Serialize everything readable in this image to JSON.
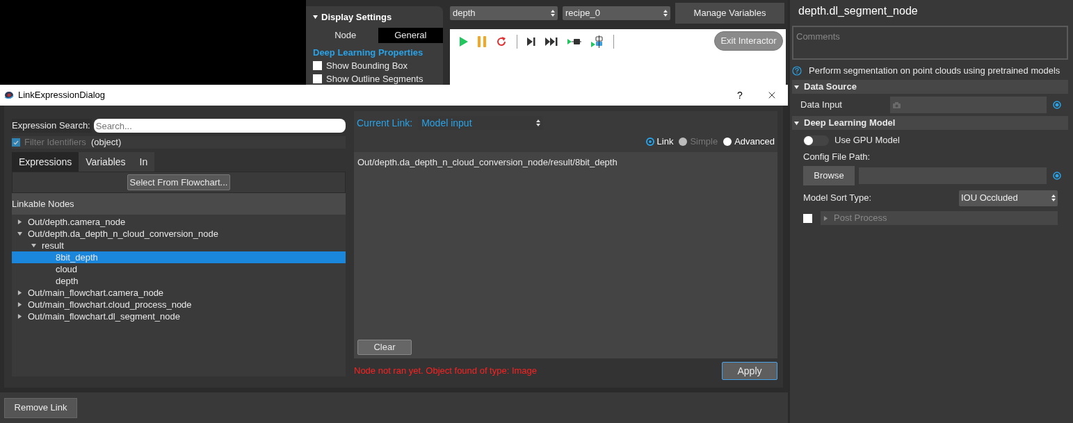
{
  "background": {
    "display_settings": {
      "title": "Display Settings",
      "tabs": [
        {
          "label": "Node",
          "selected": false
        },
        {
          "label": "General",
          "selected": true
        }
      ],
      "section": "Deep Learning Properties",
      "checkboxes": [
        {
          "label": "Show Bounding Box",
          "checked": false
        },
        {
          "label": "Show Outline Segments",
          "checked": false
        }
      ]
    },
    "selectors": [
      {
        "value": "depth"
      },
      {
        "value": "recipe_0"
      }
    ],
    "manage_button": "Manage Variables",
    "exit_button": "Exit Interactor"
  },
  "dialog": {
    "title": "LinkExpressionDialog",
    "help": "?",
    "search": {
      "label": "Expression Search:",
      "placeholder": "Search..."
    },
    "filter": {
      "label": "Filter Identifiers",
      "checked": true,
      "disabled": true,
      "type": "(object)"
    },
    "tabs": [
      {
        "label": "Expressions",
        "selected": true
      },
      {
        "label": "Variables",
        "selected": false
      },
      {
        "label": "In",
        "selected": false
      }
    ],
    "select_button": "Select From Flowchart...",
    "tree_header": "Linkable Nodes",
    "tree": [
      {
        "label": "Out/depth.camera_node",
        "expanded": false,
        "selected": false
      },
      {
        "label": "Out/depth.da_depth_n_cloud_conversion_node",
        "expanded": true,
        "selected": false,
        "children": [
          {
            "label": "result",
            "expanded": true,
            "selected": false,
            "children": [
              {
                "label": "8bit_depth",
                "selected": true
              },
              {
                "label": "cloud",
                "selected": false
              },
              {
                "label": "depth",
                "selected": false
              }
            ]
          }
        ]
      },
      {
        "label": "Out/main_flowchart.camera_node",
        "expanded": false,
        "selected": false
      },
      {
        "label": "Out/main_flowchart.cloud_process_node",
        "expanded": false,
        "selected": false
      },
      {
        "label": "Out/main_flowchart.dl_segment_node",
        "expanded": false,
        "selected": false
      }
    ],
    "current_link": {
      "label": "Current Link:",
      "value": "Model input"
    },
    "modes": [
      {
        "label": "Link",
        "selected": true,
        "disabled": false
      },
      {
        "label": "Simple",
        "selected": false,
        "disabled": true
      },
      {
        "label": "Advanced",
        "selected": false,
        "disabled": false
      }
    ],
    "expression": "Out/depth.da_depth_n_cloud_conversion_node/result/8bit_depth",
    "clear_button": "Clear",
    "status": "Node not ran yet. Object found of type: Image",
    "apply_button": "Apply"
  },
  "remove_button": "Remove Link",
  "properties": {
    "title": "depth.dl_segment_node",
    "comments_placeholder": "Comments",
    "description": "Perform segmentation on point clouds using pretrained models",
    "sections": [
      {
        "title": "Data Source",
        "expanded": true,
        "rows": [
          {
            "kind": "input",
            "label": "Data Input"
          }
        ]
      },
      {
        "title": "Deep Learning Model",
        "expanded": true,
        "rows": [
          {
            "kind": "toggle",
            "label": "Use GPU Model",
            "on": false
          },
          {
            "kind": "label",
            "label": "Config File Path:"
          },
          {
            "kind": "browse",
            "button": "Browse"
          },
          {
            "kind": "select",
            "label": "Model Sort Type:",
            "value": "IOU Occluded"
          },
          {
            "kind": "collapsible",
            "label": "Post Process",
            "checked": false,
            "expanded": false
          }
        ]
      }
    ]
  }
}
